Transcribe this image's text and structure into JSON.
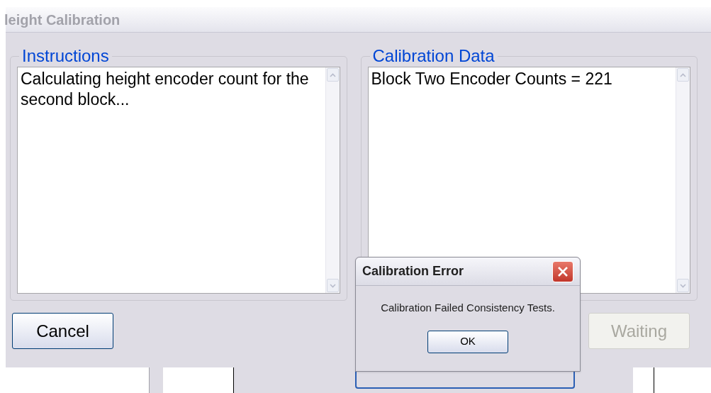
{
  "window": {
    "title": "leight Calibration"
  },
  "panels": [
    {
      "title": "Instructions",
      "text": "Calculating height encoder count for the second block..."
    },
    {
      "title": "Calibration Data",
      "text": "Block Two Encoder Counts = 221"
    }
  ],
  "buttons": [
    {
      "label": "Cancel",
      "disabled": false
    },
    {
      "label": "Waiting",
      "disabled": true
    }
  ],
  "dialog": {
    "title": "Calibration Error",
    "message": "Calibration Failed Consistency Tests.",
    "button": "OK"
  }
}
